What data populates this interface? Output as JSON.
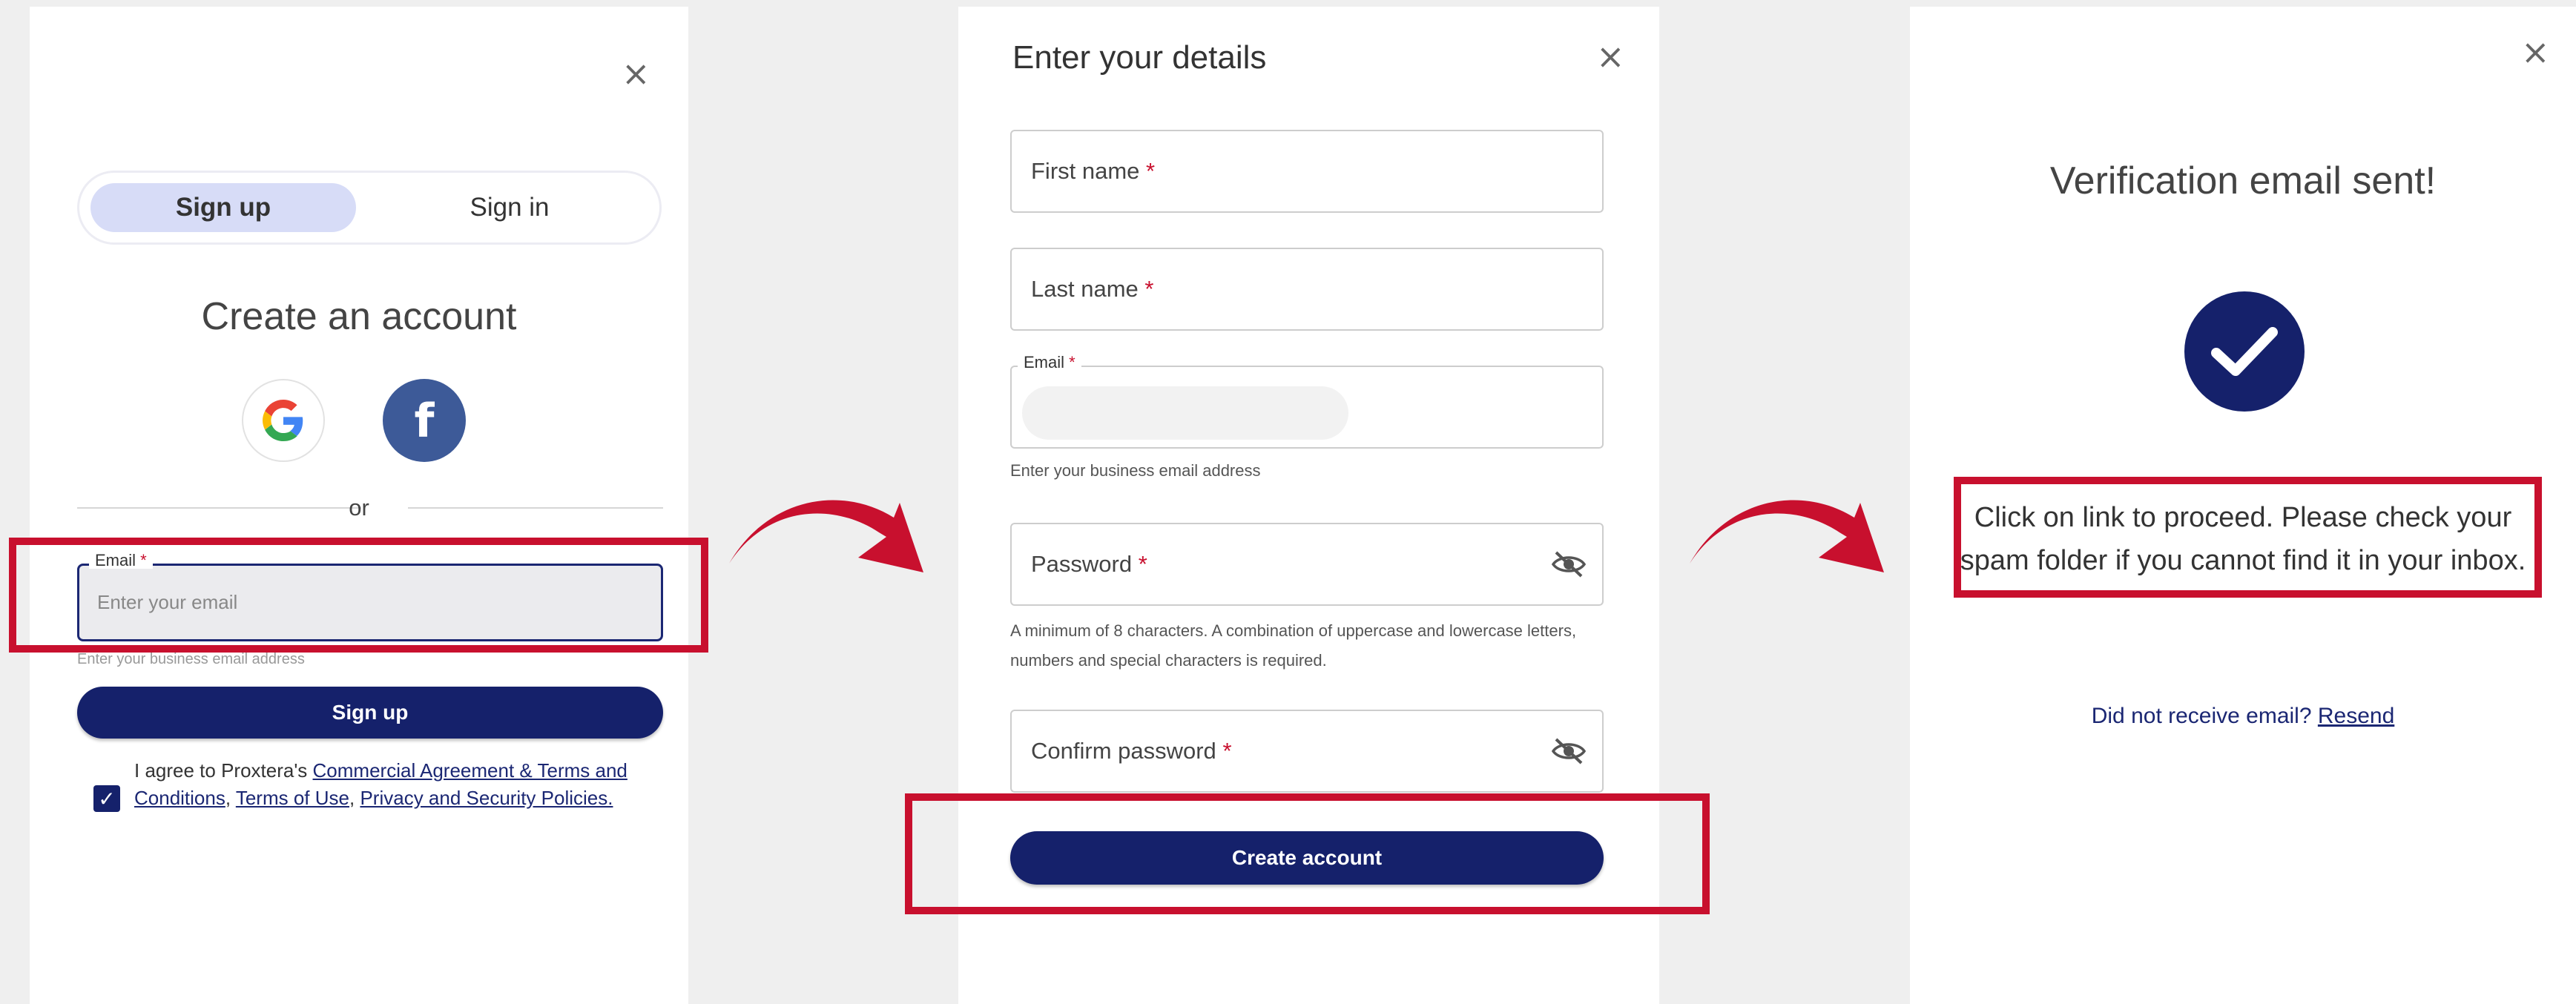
{
  "signup_panel": {
    "tabs": [
      {
        "label": "Sign up",
        "active": true
      },
      {
        "label": "Sign in",
        "active": false
      }
    ],
    "title": "Create an account",
    "social": [
      "google-icon",
      "facebook-icon"
    ],
    "facebook_glyph": "f",
    "divider_text": "or",
    "email_legend": "Email",
    "required_mark": "*",
    "email_placeholder": "Enter your email",
    "email_hint": "Enter your business email address",
    "signup_button": "Sign up",
    "agree_prefix": "I agree to Proxtera's ",
    "agree_link1": "Commercial Agreement & Terms and Conditions",
    "agree_sep1": ", ",
    "agree_link2": "Terms of Use",
    "agree_sep2": ", ",
    "agree_link3": "Privacy and Security Policies.",
    "agree_checked": true
  },
  "details_panel": {
    "title": "Enter your details",
    "first_name_label": "First name",
    "last_name_label": "Last name",
    "email_legend": "Email",
    "email_hint": "Enter your business email address",
    "password_label": "Password",
    "password_hint": "A minimum of 8 characters. A combination of uppercase and lowercase letters, numbers and special characters is required.",
    "confirm_password_label": "Confirm password",
    "required_mark": "*",
    "create_button": "Create account"
  },
  "verify_panel": {
    "title": "Verification email sent!",
    "message": "Click on link to proceed. Please check your spam folder if you cannot find it in your inbox.",
    "resend_prompt": "Did not receive email? ",
    "resend_link": "Resend"
  },
  "close_glyph": "×",
  "colors": {
    "accent": "#15216b",
    "highlight": "#c8102e",
    "tab_active_bg": "#d7dcf7",
    "facebook": "#3d5a98"
  }
}
